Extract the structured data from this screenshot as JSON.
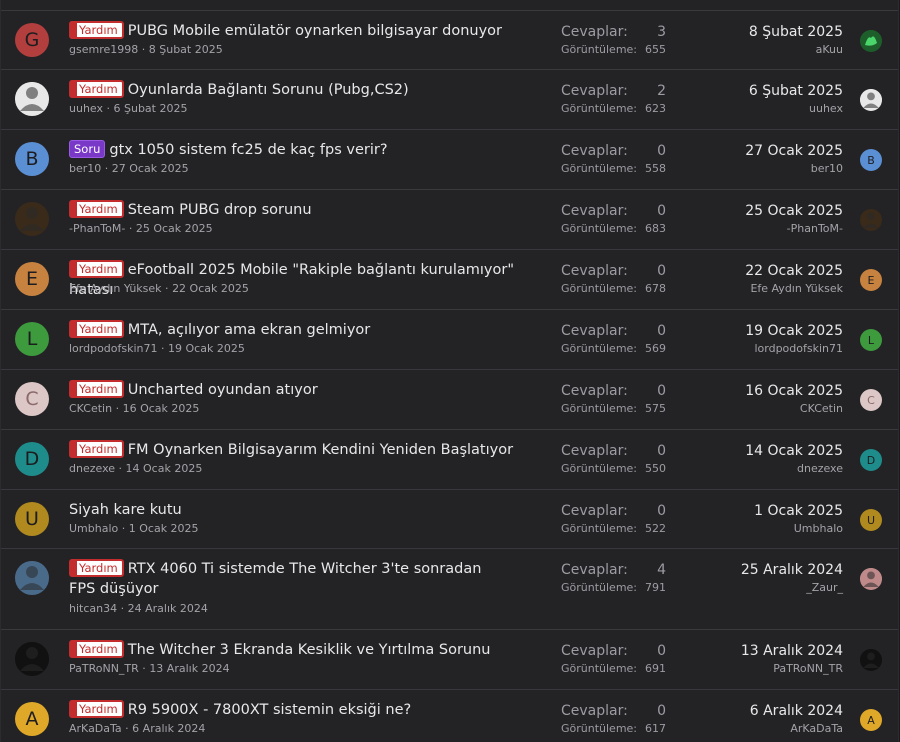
{
  "labels": {
    "replies": "Cevaplar:",
    "views": "Görüntüleme:"
  },
  "threads": [
    {
      "avatar": {
        "letter": "G",
        "bg": "#b33e3e",
        "color": "#1d1d1f"
      },
      "prefix": "Yardım",
      "prefix_color": "red",
      "title": "PUBG Mobile emülatör oynarken bilgisayar donuyor",
      "author": "gsemre1998",
      "date": "8 Şubat 2025",
      "replies": "3",
      "views": "655",
      "last_date": "8 Şubat 2025",
      "last_user": "aKuu",
      "last_avatar": {
        "letter": "",
        "bg": "#1d5e2a",
        "icon": "green-figure-icon"
      }
    },
    {
      "avatar": {
        "letter": "",
        "bg": "#e8e8e8",
        "icon": "profile-photo-icon"
      },
      "prefix": "Yardım",
      "prefix_color": "red",
      "title": "Oyunlarda Bağlantı Sorunu (Pubg,CS2)",
      "author": "uuhex",
      "date": "6 Şubat 2025",
      "replies": "2",
      "views": "623",
      "last_date": "6 Şubat 2025",
      "last_user": "uuhex",
      "last_avatar": {
        "letter": "",
        "bg": "#e8e8e8",
        "icon": "profile-photo-icon"
      }
    },
    {
      "avatar": {
        "letter": "B",
        "bg": "#5b8fd4",
        "color": "#1d1d1f"
      },
      "prefix": "Soru",
      "prefix_color": "purple",
      "title": "gtx 1050 sistem fc25 de kaç fps verir?",
      "author": "ber10",
      "date": "27 Ocak 2025",
      "replies": "0",
      "views": "558",
      "last_date": "27 Ocak 2025",
      "last_user": "ber10",
      "last_avatar": {
        "letter": "B",
        "bg": "#5b8fd4"
      }
    },
    {
      "avatar": {
        "letter": "",
        "bg": "#3a2a1a",
        "icon": "profile-photo-icon"
      },
      "prefix": "Yardım",
      "prefix_color": "red",
      "title": "Steam PUBG drop sorunu",
      "author": "-PhanToM-",
      "date": "25 Ocak 2025",
      "replies": "0",
      "views": "683",
      "last_date": "25 Ocak 2025",
      "last_user": "-PhanToM-",
      "last_avatar": {
        "letter": "",
        "bg": "#3a2a1a",
        "icon": "profile-photo-icon"
      }
    },
    {
      "avatar": {
        "letter": "E",
        "bg": "#c7823f",
        "color": "#1d1d1f"
      },
      "prefix": "Yardım",
      "prefix_color": "red",
      "title": "eFootball 2025 Mobile \"Rakiple bağlantı kurulamıyor\" hatası",
      "author": "Efe Aydın Yüksek",
      "date": "22 Ocak 2025",
      "replies": "0",
      "views": "678",
      "last_date": "22 Ocak 2025",
      "last_user": "Efe Aydın Yüksek",
      "last_avatar": {
        "letter": "E",
        "bg": "#c7823f"
      }
    },
    {
      "avatar": {
        "letter": "L",
        "bg": "#3d9a3d",
        "color": "#1d1d1f"
      },
      "prefix": "Yardım",
      "prefix_color": "red",
      "title": "MTA, açılıyor ama ekran gelmiyor",
      "author": "lordpodofskin71",
      "date": "19 Ocak 2025",
      "replies": "0",
      "views": "569",
      "last_date": "19 Ocak 2025",
      "last_user": "lordpodofskin71",
      "last_avatar": {
        "letter": "L",
        "bg": "#3d9a3d"
      }
    },
    {
      "avatar": {
        "letter": "C",
        "bg": "#dcc6c6",
        "color": "#8a6a6a"
      },
      "prefix": "Yardım",
      "prefix_color": "red",
      "title": "Uncharted oyundan atıyor",
      "author": "CKCetin",
      "date": "16 Ocak 2025",
      "replies": "0",
      "views": "575",
      "last_date": "16 Ocak 2025",
      "last_user": "CKCetin",
      "last_avatar": {
        "letter": "C",
        "bg": "#dcc6c6",
        "color": "#8a6a6a"
      }
    },
    {
      "avatar": {
        "letter": "D",
        "bg": "#1f8c8c",
        "color": "#1d1d1f"
      },
      "prefix": "Yardım",
      "prefix_color": "red",
      "title": "FM Oynarken Bilgisayarım Kendini Yeniden Başlatıyor",
      "author": "dnezexe",
      "date": "14 Ocak 2025",
      "replies": "0",
      "views": "550",
      "last_date": "14 Ocak 2025",
      "last_user": "dnezexe",
      "last_avatar": {
        "letter": "D",
        "bg": "#1f8c8c"
      }
    },
    {
      "avatar": {
        "letter": "U",
        "bg": "#b0891f",
        "color": "#1d1d1f"
      },
      "prefix": "",
      "prefix_color": "",
      "title": "Siyah kare kutu",
      "author": "Umbhalo",
      "date": "1 Ocak 2025",
      "replies": "0",
      "views": "522",
      "last_date": "1 Ocak 2025",
      "last_user": "Umbhalo",
      "last_avatar": {
        "letter": "U",
        "bg": "#b0891f"
      }
    },
    {
      "avatar": {
        "letter": "",
        "bg": "#4a6a8a",
        "icon": "profile-photo-icon"
      },
      "prefix": "Yardım",
      "prefix_color": "red",
      "title": "RTX 4060 Ti sistemde The Witcher 3'te sonradan FPS düşüyor",
      "author": "hitcan34",
      "date": "24 Aralık 2024",
      "replies": "4",
      "views": "791",
      "last_date": "25 Aralık 2024",
      "last_user": "_Zaur_",
      "last_avatar": {
        "letter": "",
        "bg": "#c08a8a",
        "icon": "profile-photo-icon"
      }
    },
    {
      "avatar": {
        "letter": "",
        "bg": "#111111",
        "icon": "profile-photo-icon"
      },
      "prefix": "Yardım",
      "prefix_color": "red",
      "title": "The Witcher 3 Ekranda Kesiklik ve Yırtılma Sorunu",
      "author": "PaTRoNN_TR",
      "date": "13 Aralık 2024",
      "replies": "0",
      "views": "691",
      "last_date": "13 Aralık 2024",
      "last_user": "PaTRoNN_TR",
      "last_avatar": {
        "letter": "",
        "bg": "#111111",
        "icon": "profile-photo-icon"
      }
    },
    {
      "avatar": {
        "letter": "A",
        "bg": "#e0a829",
        "color": "#1d1d1f"
      },
      "prefix": "Yardım",
      "prefix_color": "red",
      "title": "R9 5900X - 7800XT sistemin eksiği ne?",
      "author": "ArKaDaTa",
      "date": "6 Aralık 2024",
      "replies": "0",
      "views": "617",
      "last_date": "6 Aralık 2024",
      "last_user": "ArKaDaTa",
      "last_avatar": {
        "letter": "A",
        "bg": "#e0a829"
      }
    }
  ]
}
